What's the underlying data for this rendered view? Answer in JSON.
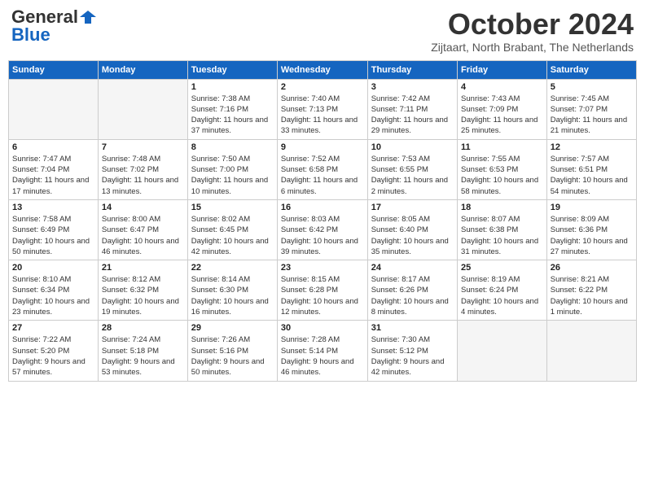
{
  "header": {
    "logo_general": "General",
    "logo_blue": "Blue",
    "month_title": "October 2024",
    "subtitle": "Zijtaart, North Brabant, The Netherlands"
  },
  "days_of_week": [
    "Sunday",
    "Monday",
    "Tuesday",
    "Wednesday",
    "Thursday",
    "Friday",
    "Saturday"
  ],
  "weeks": [
    [
      {
        "day": "",
        "empty": true
      },
      {
        "day": "",
        "empty": true
      },
      {
        "day": "1",
        "sunrise": "7:38 AM",
        "sunset": "7:16 PM",
        "daylight": "11 hours and 37 minutes."
      },
      {
        "day": "2",
        "sunrise": "7:40 AM",
        "sunset": "7:13 PM",
        "daylight": "11 hours and 33 minutes."
      },
      {
        "day": "3",
        "sunrise": "7:42 AM",
        "sunset": "7:11 PM",
        "daylight": "11 hours and 29 minutes."
      },
      {
        "day": "4",
        "sunrise": "7:43 AM",
        "sunset": "7:09 PM",
        "daylight": "11 hours and 25 minutes."
      },
      {
        "day": "5",
        "sunrise": "7:45 AM",
        "sunset": "7:07 PM",
        "daylight": "11 hours and 21 minutes."
      }
    ],
    [
      {
        "day": "6",
        "sunrise": "7:47 AM",
        "sunset": "7:04 PM",
        "daylight": "11 hours and 17 minutes."
      },
      {
        "day": "7",
        "sunrise": "7:48 AM",
        "sunset": "7:02 PM",
        "daylight": "11 hours and 13 minutes."
      },
      {
        "day": "8",
        "sunrise": "7:50 AM",
        "sunset": "7:00 PM",
        "daylight": "11 hours and 10 minutes."
      },
      {
        "day": "9",
        "sunrise": "7:52 AM",
        "sunset": "6:58 PM",
        "daylight": "11 hours and 6 minutes."
      },
      {
        "day": "10",
        "sunrise": "7:53 AM",
        "sunset": "6:55 PM",
        "daylight": "11 hours and 2 minutes."
      },
      {
        "day": "11",
        "sunrise": "7:55 AM",
        "sunset": "6:53 PM",
        "daylight": "10 hours and 58 minutes."
      },
      {
        "day": "12",
        "sunrise": "7:57 AM",
        "sunset": "6:51 PM",
        "daylight": "10 hours and 54 minutes."
      }
    ],
    [
      {
        "day": "13",
        "sunrise": "7:58 AM",
        "sunset": "6:49 PM",
        "daylight": "10 hours and 50 minutes."
      },
      {
        "day": "14",
        "sunrise": "8:00 AM",
        "sunset": "6:47 PM",
        "daylight": "10 hours and 46 minutes."
      },
      {
        "day": "15",
        "sunrise": "8:02 AM",
        "sunset": "6:45 PM",
        "daylight": "10 hours and 42 minutes."
      },
      {
        "day": "16",
        "sunrise": "8:03 AM",
        "sunset": "6:42 PM",
        "daylight": "10 hours and 39 minutes."
      },
      {
        "day": "17",
        "sunrise": "8:05 AM",
        "sunset": "6:40 PM",
        "daylight": "10 hours and 35 minutes."
      },
      {
        "day": "18",
        "sunrise": "8:07 AM",
        "sunset": "6:38 PM",
        "daylight": "10 hours and 31 minutes."
      },
      {
        "day": "19",
        "sunrise": "8:09 AM",
        "sunset": "6:36 PM",
        "daylight": "10 hours and 27 minutes."
      }
    ],
    [
      {
        "day": "20",
        "sunrise": "8:10 AM",
        "sunset": "6:34 PM",
        "daylight": "10 hours and 23 minutes."
      },
      {
        "day": "21",
        "sunrise": "8:12 AM",
        "sunset": "6:32 PM",
        "daylight": "10 hours and 19 minutes."
      },
      {
        "day": "22",
        "sunrise": "8:14 AM",
        "sunset": "6:30 PM",
        "daylight": "10 hours and 16 minutes."
      },
      {
        "day": "23",
        "sunrise": "8:15 AM",
        "sunset": "6:28 PM",
        "daylight": "10 hours and 12 minutes."
      },
      {
        "day": "24",
        "sunrise": "8:17 AM",
        "sunset": "6:26 PM",
        "daylight": "10 hours and 8 minutes."
      },
      {
        "day": "25",
        "sunrise": "8:19 AM",
        "sunset": "6:24 PM",
        "daylight": "10 hours and 4 minutes."
      },
      {
        "day": "26",
        "sunrise": "8:21 AM",
        "sunset": "6:22 PM",
        "daylight": "10 hours and 1 minute."
      }
    ],
    [
      {
        "day": "27",
        "sunrise": "7:22 AM",
        "sunset": "5:20 PM",
        "daylight": "9 hours and 57 minutes."
      },
      {
        "day": "28",
        "sunrise": "7:24 AM",
        "sunset": "5:18 PM",
        "daylight": "9 hours and 53 minutes."
      },
      {
        "day": "29",
        "sunrise": "7:26 AM",
        "sunset": "5:16 PM",
        "daylight": "9 hours and 50 minutes."
      },
      {
        "day": "30",
        "sunrise": "7:28 AM",
        "sunset": "5:14 PM",
        "daylight": "9 hours and 46 minutes."
      },
      {
        "day": "31",
        "sunrise": "7:30 AM",
        "sunset": "5:12 PM",
        "daylight": "9 hours and 42 minutes."
      },
      {
        "day": "",
        "empty": true
      },
      {
        "day": "",
        "empty": true
      }
    ]
  ]
}
